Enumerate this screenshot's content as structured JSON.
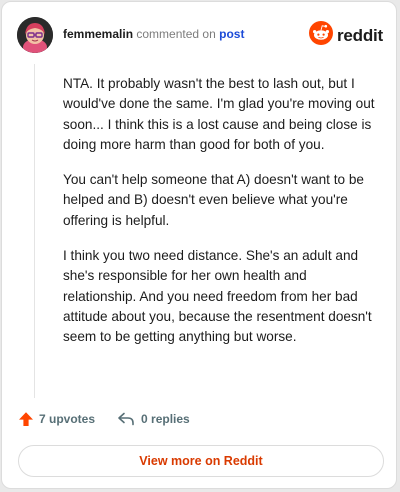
{
  "header": {
    "username": "femmemalin",
    "action_text": "commented on",
    "post_link": "post",
    "brand": "reddit"
  },
  "comment": {
    "paragraphs": [
      "NTA. It probably wasn't the best to lash out, but I would've done the same. I'm glad you're moving out soon... I think this is a lost cause and being close is doing more harm than good for both of you.",
      "You can't help someone that A) doesn't want to be helped and B) doesn't even believe what you're offering is helpful.",
      "I think you two need distance. She's an adult and she's responsible for her own health and relationship. And you need freedom from her bad attitude about you, because the resentment doesn't seem to be getting anything but worse."
    ]
  },
  "actions": {
    "upvotes_label": "7 upvotes",
    "replies_label": "0 replies"
  },
  "footer": {
    "view_more_label": "View more on Reddit"
  },
  "colors": {
    "brand_orange": "#ff4500",
    "upvote_orange": "#ff4500",
    "link_blue": "#1c4bd8",
    "view_more_text": "#d93a00"
  },
  "icons": {
    "avatar": "avatar",
    "logo": "reddit-snoo-icon",
    "upvote": "upvote-arrow-icon",
    "reply": "reply-arrow-icon"
  }
}
